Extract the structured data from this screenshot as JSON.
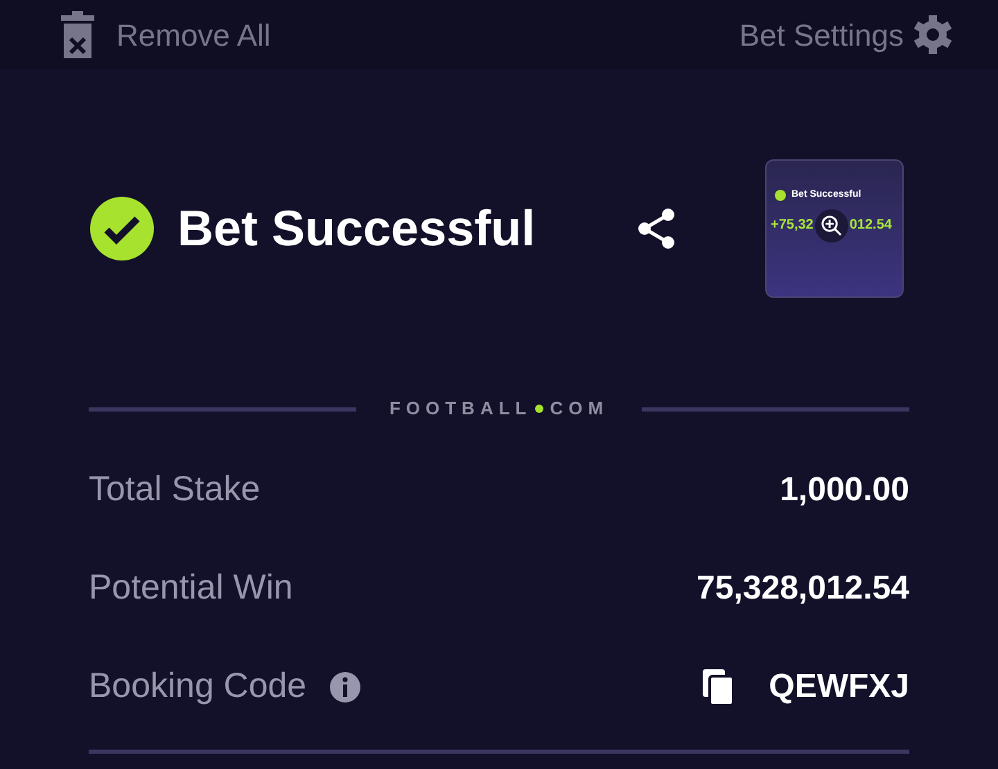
{
  "toolbar": {
    "remove_all": "Remove All",
    "bet_settings": "Bet Settings"
  },
  "result": {
    "title": "Bet Successful",
    "thumbnail": {
      "title": "Bet Successful",
      "amount_start": "+75,32",
      "amount_end": "012.54"
    }
  },
  "brand": {
    "left": "FOOTBALL",
    "right": "COM"
  },
  "details": [
    {
      "kind": "plain",
      "label": "Total Stake",
      "value": "1,000.00"
    },
    {
      "kind": "plain",
      "label": "Potential Win",
      "value": "75,328,012.54"
    },
    {
      "kind": "code",
      "label": "Booking Code",
      "value": "QEWFXJ"
    }
  ]
}
